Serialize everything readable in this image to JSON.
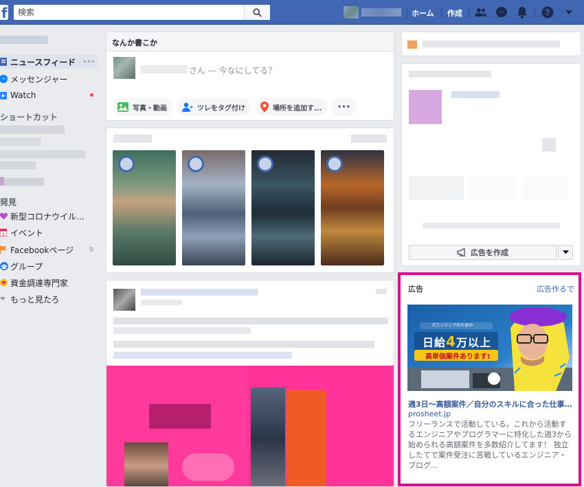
{
  "topbar": {
    "logo": "f",
    "search_placeholder": "検索",
    "home_label": "ホーム",
    "create_label": "作成"
  },
  "sidebar": {
    "items": [
      {
        "label": "ニュースフィード",
        "more": "•••"
      },
      {
        "label": "メッセンジャー"
      },
      {
        "label": "Watch",
        "dot": true
      }
    ],
    "shortcuts_heading": "ショートカット",
    "explore_heading": "発見",
    "explore": [
      {
        "label": "新型コロナウイル..."
      },
      {
        "label": "イベント"
      },
      {
        "label": "Facebookページ",
        "count": "9"
      },
      {
        "label": "グループ"
      },
      {
        "label": "資金調達専門家"
      }
    ],
    "more_label": "もっと見たろ"
  },
  "composer": {
    "heading": "なんか書こか",
    "prompt": "さん — 今なにしてる？",
    "actions": [
      {
        "label": "写真・動画",
        "icon": "photo-icon"
      },
      {
        "label": "ツレをタグ付け",
        "icon": "tag-friends-icon"
      },
      {
        "label": "場所を追加す...",
        "icon": "location-pin-icon"
      }
    ],
    "more": "•••"
  },
  "page_card": {
    "create_ad_label": "広告を作成"
  },
  "ad": {
    "label": "広告",
    "create_link": "広告作るで",
    "image_badge": "ITエンジニアのための",
    "image_line1_pre": "日給",
    "image_line1_num": "4",
    "image_line1_post": "万以上",
    "image_line2": "高単価案件あります!",
    "headline": "週3日〜高額案件／自分のスキルに合った仕事...",
    "domain": "prosheet.jp",
    "body": "フリーランスで活動している。これから活動するエンジニアやプログラマーに特化した週3から始められる高額案件を多数紹介してます！ 独立したてで案件受注に苦戦しているエンジニア・ブログ..."
  },
  "colors": {
    "brand": "#4267b2",
    "ad_highlight": "#d90f8d",
    "post_image": "#ff3399"
  }
}
